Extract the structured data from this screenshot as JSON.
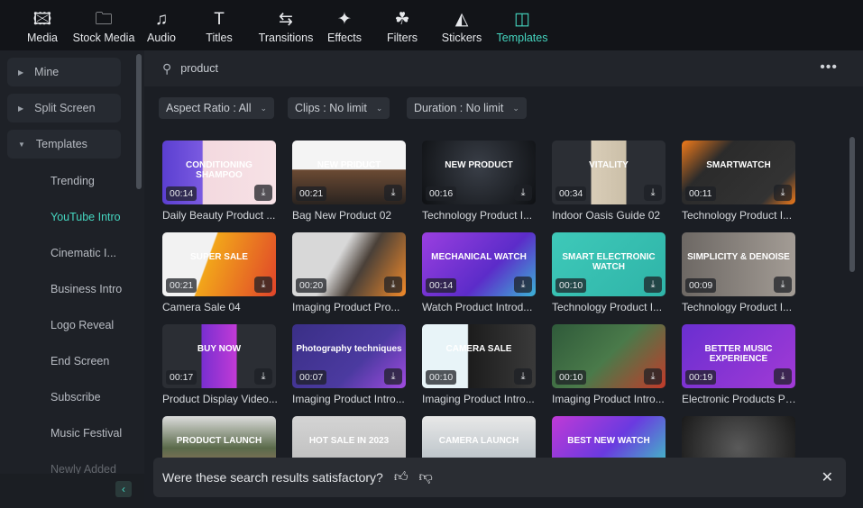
{
  "topbar": {
    "tabs": [
      {
        "label": "Media",
        "icon": "media-icon",
        "glyph": "🖾"
      },
      {
        "label": "Stock Media",
        "icon": "stock-media-icon",
        "glyph": "🗀"
      },
      {
        "label": "Audio",
        "icon": "audio-icon",
        "glyph": "♫"
      },
      {
        "label": "Titles",
        "icon": "titles-icon",
        "glyph": "T"
      },
      {
        "label": "Transitions",
        "icon": "transitions-icon",
        "glyph": "⇆"
      },
      {
        "label": "Effects",
        "icon": "effects-icon",
        "glyph": "✦"
      },
      {
        "label": "Filters",
        "icon": "filters-icon",
        "glyph": "☘"
      },
      {
        "label": "Stickers",
        "icon": "stickers-icon",
        "glyph": "◭"
      },
      {
        "label": "Templates",
        "icon": "templates-icon",
        "glyph": "◫",
        "active": true
      }
    ]
  },
  "sidebar": {
    "groups": [
      "Mine",
      "Split Screen",
      "Templates"
    ],
    "subitems": [
      "Trending",
      "YouTube Intro",
      "Cinematic I...",
      "Business Intro",
      "Logo Reveal",
      "End Screen",
      "Subscribe",
      "Music Festival",
      "Newly Added"
    ],
    "active": "YouTube Intro"
  },
  "search": {
    "value": "product"
  },
  "filters": [
    "Aspect Ratio : All",
    "Clips : No limit",
    "Duration : No limit"
  ],
  "cards": [
    {
      "title": "Daily Beauty Product ...",
      "duration": "00:14",
      "overlay": "CONDITIONING SHAMPOO",
      "bg": "linear-gradient(90deg,#5b3fd1 0%,#7a5ae0 35%,#f3d9df 36%,#f7e2e6 100%)"
    },
    {
      "title": "Bag New Product 02",
      "duration": "00:21",
      "overlay": "NEW PRIDUCT",
      "bg": "linear-gradient(180deg,#f4f4f4 45%,#6b4a33 46%,#2a2420 100%)"
    },
    {
      "title": "Technology Product I...",
      "duration": "00:16",
      "overlay": "NEW PRODUCT",
      "bg": "radial-gradient(circle at 50% 40%,#3a3f48,#0e1013)"
    },
    {
      "title": "Indoor Oasis Guide 02",
      "duration": "00:34",
      "overlay": "VITALITY",
      "bg": "linear-gradient(90deg,#2b2e34 34%,#d9cdb8 35%,#cbbfa8 65%,#2b2e34 66%)"
    },
    {
      "title": "Technology Product I...",
      "duration": "00:11",
      "overlay": "SMARTWATCH",
      "bg": "linear-gradient(135deg,#f07a1a,#2b2b2b 30%,#333 80%,#f07a1a)"
    },
    {
      "title": "Camera Sale 04",
      "duration": "00:21",
      "overlay": "SUPER SALE",
      "bg": "linear-gradient(110deg,#f2f2f2 40%,#f2a51a 41%,#e0442a 100%)"
    },
    {
      "title": "Imaging Product Pro...",
      "duration": "00:20",
      "overlay": "",
      "bg": "linear-gradient(120deg,#d8d8d8 40%,#4a4038 60%,#f28a2a 100%)"
    },
    {
      "title": "Watch Product Introd...",
      "duration": "00:14",
      "overlay": "MECHANICAL WATCH",
      "bg": "linear-gradient(135deg,#9b3fe0,#5c2cc9 60%,#3bb3d6)"
    },
    {
      "title": "Technology Product I...",
      "duration": "00:10",
      "overlay": "SMART ELECTRONIC WATCH",
      "bg": "linear-gradient(135deg,#3ec9b9,#2fb4a8)"
    },
    {
      "title": "Technology Product I...",
      "duration": "00:09",
      "overlay": "SIMPLICITY & DENOISE",
      "bg": "linear-gradient(90deg,#6d6864,#a39c95)"
    },
    {
      "title": "Product Display Video...",
      "duration": "00:17",
      "overlay": "BUY NOW",
      "bg": "linear-gradient(90deg,#2b2e34 34%,#7a2fd0 35%,#c03ad6 65%,#2b2e34 66%)"
    },
    {
      "title": "Imaging Product Intro...",
      "duration": "00:07",
      "overlay": "Photography techniques",
      "bg": "linear-gradient(135deg,#3a2f86,#4b3aa0 60%,#a04be0)"
    },
    {
      "title": "Imaging Product Intro...",
      "duration": "00:10",
      "overlay": "CAMERA SALE",
      "bg": "linear-gradient(90deg,#e8f4f8 40%,#1c1c1c 41%,#3a3a3a 100%)"
    },
    {
      "title": "Imaging Product Intro...",
      "duration": "00:10",
      "overlay": "",
      "bg": "linear-gradient(135deg,#2f5a3a,#4a7a4a 50%,#c23a2a)"
    },
    {
      "title": "Electronic Products Pr...",
      "duration": "00:19",
      "overlay": "BETTER MUSIC EXPERIENCE",
      "bg": "linear-gradient(135deg,#6a2fd0,#a23ad6)"
    },
    {
      "title": "",
      "duration": "",
      "overlay": "PRODUCT LAUNCH",
      "bg": "linear-gradient(180deg,#dcdcdc,#5a6a4a 50%,#b07a6a)"
    },
    {
      "title": "",
      "duration": "",
      "overlay": "HOT SALE IN 2023",
      "bg": "linear-gradient(180deg,#d4d4d4,#b8b8b8)"
    },
    {
      "title": "",
      "duration": "",
      "overlay": "CAMERA LAUNCH",
      "bg": "linear-gradient(180deg,#e8e8e8,#a8b4bc)"
    },
    {
      "title": "",
      "duration": "",
      "overlay": "BEST NEW WATCH",
      "bg": "linear-gradient(135deg,#c03ad6,#6a3ae0 50%,#3ad6c0)"
    },
    {
      "title": "",
      "duration": "",
      "overlay": "",
      "bg": "radial-gradient(circle,#5a5a5a,#1a1a1a)"
    }
  ],
  "feedback": {
    "question": "Were these search results satisfactory?"
  }
}
